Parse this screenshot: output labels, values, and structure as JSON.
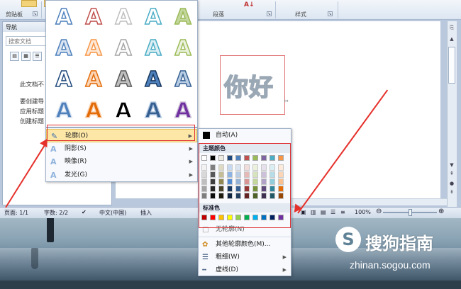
{
  "ribbon": {
    "groups": [
      {
        "name": "clipboard",
        "label": "剪贴板"
      },
      {
        "name": "paragraph",
        "label": "段落"
      },
      {
        "name": "styles",
        "label": "样式"
      }
    ]
  },
  "nav_pane": {
    "title": "导航",
    "search_placeholder": "搜索文档",
    "lines": [
      "此文档不",
      "要创建导",
      "应用标题",
      "创建标题"
    ]
  },
  "document": {
    "text": "你好"
  },
  "status_bar": {
    "page": "页面: 1/1",
    "words": "字数: 2/2",
    "language": "中文(中国)",
    "mode": "插入",
    "zoom": "100%"
  },
  "text_effects_menu": {
    "items": [
      {
        "label": "轮廓(O)",
        "icon": "outline-pen-icon"
      },
      {
        "label": "阴影(S)",
        "icon": "shadow-a-icon"
      },
      {
        "label": "映像(R)",
        "icon": "reflection-a-icon"
      },
      {
        "label": "发光(G)",
        "icon": "glow-a-icon"
      }
    ]
  },
  "outline_menu": {
    "auto_label": "自动(A)",
    "theme_colors_label": "主题颜色",
    "standard_colors_label": "标准色",
    "no_outline_label": "无轮廓(N)",
    "more_colors_label": "其他轮廓颜色(M)...",
    "weight_label": "粗细(W)",
    "dashes_label": "虚线(D)",
    "theme_colors": [
      "#ffffff",
      "#000000",
      "#eeece1",
      "#1f497d",
      "#4f81bd",
      "#c0504d",
      "#9bbb59",
      "#8064a2",
      "#4bacc6",
      "#f79646"
    ],
    "theme_shades": [
      [
        "#f2f2f2",
        "#7f7f7f",
        "#ddd9c3",
        "#c6d9f0",
        "#dbe5f1",
        "#f2dcdb",
        "#ebf1dd",
        "#e5e0ec",
        "#dbeef3",
        "#fdeada"
      ],
      [
        "#d8d8d8",
        "#595959",
        "#c4bd97",
        "#8db3e2",
        "#b8cce4",
        "#e5b9b7",
        "#d7e3bc",
        "#ccc1d9",
        "#b7dde8",
        "#fbd5b5"
      ],
      [
        "#bfbfbf",
        "#3f3f3f",
        "#938953",
        "#548dd4",
        "#95b3d7",
        "#d99694",
        "#c3d69b",
        "#b2a2c7",
        "#92cddc",
        "#fac08f"
      ],
      [
        "#a5a5a5",
        "#262626",
        "#494429",
        "#17365d",
        "#366092",
        "#953734",
        "#76923c",
        "#5f497a",
        "#31859b",
        "#e36c09"
      ],
      [
        "#7f7f7f",
        "#0c0c0c",
        "#1d1b10",
        "#0f243e",
        "#244061",
        "#632423",
        "#4f6128",
        "#3f3151",
        "#205867",
        "#974806"
      ]
    ],
    "standard_colors": [
      "#c00000",
      "#ff0000",
      "#ffc000",
      "#ffff00",
      "#92d050",
      "#00b050",
      "#00b0f0",
      "#0070c0",
      "#002060",
      "#7030a0"
    ]
  },
  "wordart_gallery": {
    "rows": [
      [
        {
          "fill": "#ffffff",
          "stroke": "#4f81bd"
        },
        {
          "fill": "#ffffff",
          "stroke": "#c0504d"
        },
        {
          "fill": "#ffffff",
          "stroke": "#bfbfbf"
        },
        {
          "fill": "#ffffff",
          "stroke": "#4bacc6"
        },
        {
          "fill": "#c3d69b",
          "stroke": "#9bbb59"
        }
      ],
      [
        {
          "fill": "#dbe5f1",
          "stroke": "#4f81bd"
        },
        {
          "fill": "#fde9d9",
          "stroke": "#f79646"
        },
        {
          "fill": "#ffffff",
          "stroke": "#a6a6a6"
        },
        {
          "fill": "#dbeef3",
          "stroke": "#4bacc6"
        },
        {
          "fill": "#ebf1dd",
          "stroke": "#9bbb59"
        }
      ],
      [
        {
          "fill": "#ffffff",
          "stroke": "#1f497d"
        },
        {
          "fill": "#fbd5b5",
          "stroke": "#e36c09"
        },
        {
          "fill": "#bfbfbf",
          "stroke": "#595959"
        },
        {
          "fill": "#4f81bd",
          "stroke": "#17365d"
        },
        {
          "fill": "#b8cce4",
          "stroke": "#366092"
        }
      ],
      [
        {
          "fill": "#4f81bd",
          "stroke": "#dbe5f1"
        },
        {
          "fill": "#e36c09",
          "stroke": "#fbd5b5"
        },
        {
          "fill": "#000000",
          "stroke": "#ffffff"
        },
        {
          "fill": "#366092",
          "stroke": "#b8cce4"
        },
        {
          "fill": "#7030a0",
          "stroke": "#ccc1d9"
        }
      ]
    ],
    "glyph": "A"
  },
  "watermark": {
    "logo": "S",
    "title": "搜狗指南",
    "url": "zhinan.sogou.com"
  },
  "colors": {
    "accent_red": "#e5312b",
    "menu_highlight": "#fde7a6"
  }
}
